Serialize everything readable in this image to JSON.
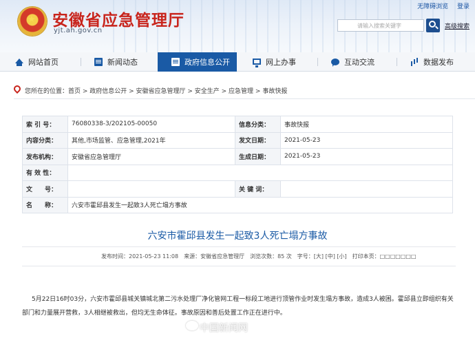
{
  "header": {
    "site_title": "安徽省应急管理厅",
    "site_url": "yjt.ah.gov.cn",
    "top_links": [
      "无障碍浏览",
      "登录"
    ],
    "search_placeholder": "请输入搜索关键字",
    "advanced_search": "高级搜索"
  },
  "nav": {
    "items": [
      {
        "label": "网站首页",
        "icon": "home-icon"
      },
      {
        "label": "新闻动态",
        "icon": "news-icon"
      },
      {
        "label": "政府信息公开",
        "icon": "document-icon"
      },
      {
        "label": "网上办事",
        "icon": "monitor-icon"
      },
      {
        "label": "互动交流",
        "icon": "chat-icon"
      },
      {
        "label": "数据发布",
        "icon": "chart-icon"
      }
    ],
    "active": "政府信息公开"
  },
  "breadcrumb": "您所在的位置：首页 > 政府信息公开 > 安徽省应急管理厅 > 安全生产 > 应急管理 > 事故快报",
  "meta": {
    "rows": [
      {
        "l1": "索 引 号：",
        "v1": "76080338-3/202105-00050",
        "l2": "信息分类：",
        "v2": "事故快报"
      },
      {
        "l1": "内容分类：",
        "v1": "其他,市场监管、应急管理,2021年",
        "l2": "发文日期：",
        "v2": "2021-05-23"
      },
      {
        "l1": "发布机构：",
        "v1": "安徽省应急管理厅",
        "l2": "生成日期：",
        "v2": "2021-05-23"
      },
      {
        "l1": "有 效 性：",
        "v1": ""
      },
      {
        "l1": "文　　号：",
        "v1": "",
        "l2": "关 键 词：",
        "v2": ""
      },
      {
        "l1": "名　　称：",
        "v1": "六安市霍邱县发生一起致3人死亡塌方事故"
      }
    ]
  },
  "article": {
    "title": "六安市霍邱县发生一起致3人死亡塌方事故",
    "pub_info": "发布时间：2021-05-23 11:08　来源：安徽省应急管理厅　浏览次数：85 次　字号：[大] [中] [小]　打印本页：□□□□□□□",
    "paragraph": "5月22日16时03分，六安市霍邱县城关镇城北第二污水处理厂净化管网工程一标段工地进行顶管作业时发生塌方事故，造成3人被困。霍邱县立即组织有关部门和力量展开营救，3人相继被救出，但均无生命体征。事故原因和善后处置工作正在进行中。"
  },
  "watermark": "中国新闻网"
}
